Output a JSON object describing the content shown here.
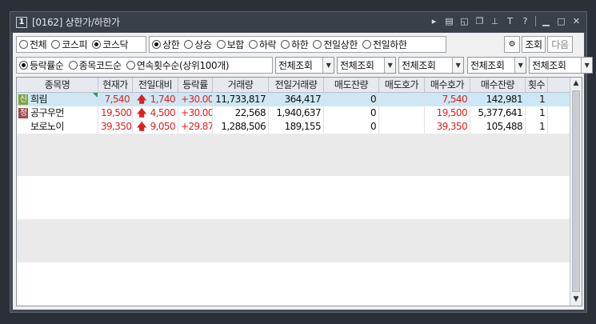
{
  "window": {
    "code": "1",
    "title": "[0162] 상한가/하한가"
  },
  "market_group": [
    {
      "label": "전체",
      "selected": false
    },
    {
      "label": "코스피",
      "selected": false
    },
    {
      "label": "코스닥",
      "selected": true
    }
  ],
  "type_group": [
    {
      "label": "상한",
      "selected": true
    },
    {
      "label": "상승",
      "selected": false
    },
    {
      "label": "보합",
      "selected": false
    },
    {
      "label": "하락",
      "selected": false
    },
    {
      "label": "하한",
      "selected": false
    },
    {
      "label": "전일상한",
      "selected": false
    },
    {
      "label": "전일하한",
      "selected": false
    }
  ],
  "buttons": {
    "query": "조회",
    "next": "다음"
  },
  "sort_group": [
    {
      "label": "등락률순",
      "selected": true
    },
    {
      "label": "종목코드순",
      "selected": false
    },
    {
      "label": "연속횟수순(상위100개)",
      "selected": false
    }
  ],
  "filters": [
    "전체조회",
    "전체조회",
    "전체조회",
    "전체조회",
    "전체조회"
  ],
  "columns": [
    "종목명",
    "현재가",
    "전일대비",
    "등락률",
    "거래량",
    "전일거래량",
    "매도잔량",
    "매도호가",
    "매수호가",
    "매수잔량",
    "횟수"
  ],
  "rows": [
    {
      "badge": "신",
      "badge_color": "#7ea33a",
      "name": "희림",
      "price": "7,540",
      "change": "1,740",
      "rate": "+30.00",
      "volume": "11,733,817",
      "prev_volume": "364,417",
      "ask_qty": "0",
      "ask": "",
      "bid": "7,540",
      "bid_qty": "142,981",
      "count": "1"
    },
    {
      "badge": "정",
      "badge_color": "#a04a4a",
      "name": "공구우먼",
      "price": "19,500",
      "change": "4,500",
      "rate": "+30.00",
      "volume": "22,568",
      "prev_volume": "1,940,637",
      "ask_qty": "0",
      "ask": "",
      "bid": "19,500",
      "bid_qty": "5,377,641",
      "count": "1"
    },
    {
      "badge": "",
      "badge_color": "",
      "name": "보로노이",
      "price": "39,350",
      "change": "9,050",
      "rate": "+29.87",
      "volume": "1,288,506",
      "prev_volume": "189,155",
      "ask_qty": "0",
      "ask": "",
      "bid": "39,350",
      "bid_qty": "105,488",
      "count": "1"
    }
  ],
  "icons": {
    "up_arrow": "up-arrow-icon",
    "window_controls": [
      "play-icon",
      "list-icon",
      "restore-icon",
      "copy-icon",
      "pin-icon",
      "font-icon",
      "help-icon",
      "minimize-icon",
      "maximize-icon",
      "close-icon"
    ]
  }
}
